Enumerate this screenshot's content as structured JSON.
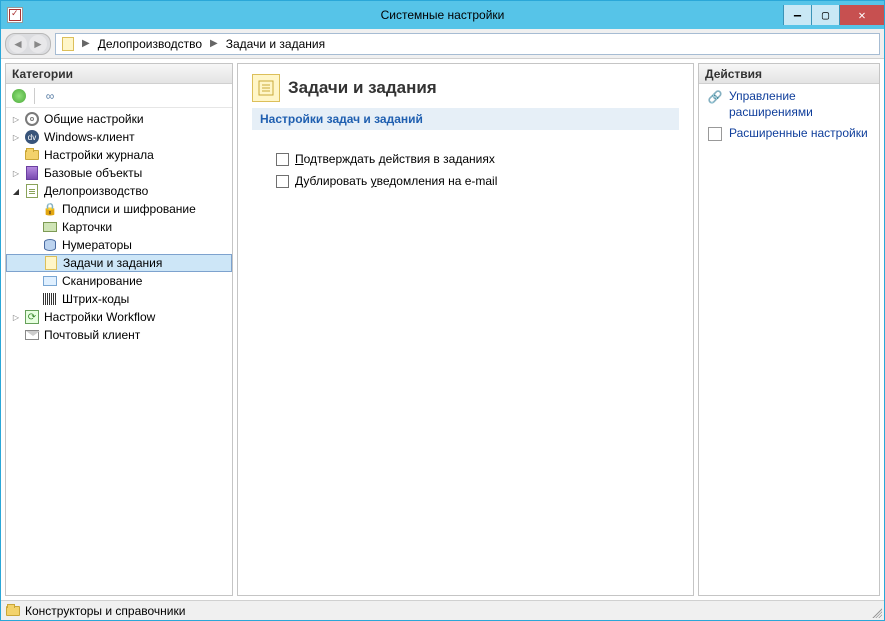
{
  "window": {
    "title": "Системные настройки"
  },
  "breadcrumb": {
    "item1": "Делопроизводство",
    "item2": "Задачи и задания"
  },
  "panels": {
    "left_header": "Категории",
    "right_header": "Действия"
  },
  "tree": {
    "n1": "Общие настройки",
    "n2": "Windows-клиент",
    "n3": "Настройки журнала",
    "n4": "Базовые объекты",
    "n5": "Делопроизводство",
    "n5a": "Подписи и шифрование",
    "n5b": "Карточки",
    "n5c": "Нумераторы",
    "n5d": "Задачи и задания",
    "n5e": "Сканирование",
    "n5f": "Штрих-коды",
    "n6": "Настройки Workflow",
    "n7": "Почтовый клиент"
  },
  "page": {
    "title": "Задачи и задания",
    "section": "Настройки задач и заданий",
    "opt1_pre": "П",
    "opt1_rest": "одтверждать действия в заданиях",
    "opt2_pre": "Дублировать ",
    "opt2_u": "у",
    "opt2_rest": "ведомления на e-mail"
  },
  "actions": {
    "a1": "Управление расширениями",
    "a2": "Расширенные настройки"
  },
  "status": {
    "text": "Конструкторы и справочники"
  }
}
